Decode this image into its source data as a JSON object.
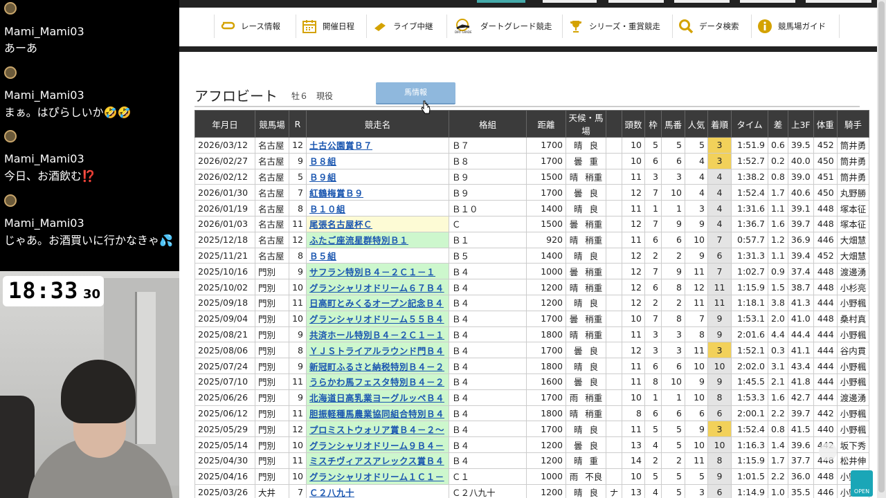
{
  "chat": {
    "messages": [
      {
        "user": "Mami_Mami03",
        "text": "あーあ"
      },
      {
        "user": "Mami_Mami03",
        "text": "まぁ。はぴらしいか🤣🤣"
      },
      {
        "user": "Mami_Mami03",
        "text": "今日、お酒飲む⁉️"
      },
      {
        "user": "Mami_Mami03",
        "text": "じゃあ。お酒買いに行かなきゃ💦"
      }
    ]
  },
  "clock": {
    "hm": "18:33",
    "sec": "30"
  },
  "nav": {
    "items": [
      {
        "label": "レース情報",
        "icon": "race-info-icon"
      },
      {
        "label": "開催日程",
        "icon": "calendar-icon"
      },
      {
        "label": "ライブ中継",
        "icon": "live-icon"
      },
      {
        "label": "ダートグレード競走",
        "icon": "dirt-grade-icon"
      },
      {
        "label": "シリーズ・重賞競走",
        "icon": "trophy-icon"
      },
      {
        "label": "データ検索",
        "icon": "search-icon"
      },
      {
        "label": "競馬場ガイド",
        "icon": "info-icon"
      }
    ]
  },
  "horse": {
    "name": "アフロビート",
    "meta": "牡６　現役",
    "button": "馬情報"
  },
  "table": {
    "headers": [
      "年月日",
      "競馬場",
      "R",
      "競走名",
      "格組",
      "距離",
      "天候・馬場",
      "",
      "頭数",
      "枠",
      "馬番",
      "人気",
      "着順",
      "タイム",
      "差",
      "上3F",
      "体重",
      "騎手"
    ],
    "rows": [
      [
        "2026/03/12",
        "名古屋",
        "12",
        "土古公園賞Ｂ７",
        "Ｂ７",
        "1700",
        "晴",
        "良",
        "",
        "10",
        "5",
        "5",
        "5",
        "3",
        "1:51.9",
        "0.6",
        "39.5",
        "452",
        "筒井勇"
      ],
      [
        "2026/02/27",
        "名古屋",
        "9",
        "Ｂ８組",
        "Ｂ８",
        "1700",
        "曇",
        "重",
        "",
        "10",
        "6",
        "6",
        "4",
        "3",
        "1:52.7",
        "0.2",
        "40.0",
        "450",
        "筒井勇"
      ],
      [
        "2026/02/12",
        "名古屋",
        "5",
        "Ｂ９組",
        "Ｂ９",
        "1500",
        "晴",
        "稍重",
        "",
        "11",
        "3",
        "3",
        "4",
        "4",
        "1:38.2",
        "0.8",
        "39.0",
        "451",
        "筒井勇"
      ],
      [
        "2026/01/30",
        "名古屋",
        "7",
        "紅鶴梅賞Ｂ９",
        "Ｂ９",
        "1700",
        "曇",
        "良",
        "",
        "12",
        "7",
        "10",
        "4",
        "4",
        "1:52.4",
        "1.7",
        "40.6",
        "450",
        "丸野勝"
      ],
      [
        "2026/01/19",
        "名古屋",
        "8",
        "Ｂ１０組",
        "Ｂ１０",
        "1400",
        "晴",
        "良",
        "",
        "11",
        "1",
        "1",
        "3",
        "4",
        "1:31.6",
        "1.1",
        "39.1",
        "448",
        "塚本征"
      ],
      [
        "2026/01/03",
        "名古屋",
        "11",
        "尾張名古屋杯Ｃ",
        "Ｃ",
        "1500",
        "曇",
        "稍重",
        "",
        "12",
        "7",
        "9",
        "9",
        "4",
        "1:36.7",
        "1.6",
        "39.7",
        "448",
        "塚本征"
      ],
      [
        "2025/12/18",
        "名古屋",
        "12",
        "ふたご座流星群特別Ｂ１",
        "Ｂ１",
        "920",
        "晴",
        "稍重",
        "",
        "11",
        "6",
        "6",
        "10",
        "7",
        "0:57.7",
        "1.2",
        "36.9",
        "446",
        "大畑慧"
      ],
      [
        "2025/11/21",
        "名古屋",
        "8",
        "Ｂ５組",
        "Ｂ５",
        "1400",
        "晴",
        "良",
        "",
        "12",
        "2",
        "2",
        "9",
        "6",
        "1:31.3",
        "1.1",
        "39.4",
        "452",
        "大畑慧"
      ],
      [
        "2025/10/16",
        "門別",
        "9",
        "サフラン特別Ｂ４－２Ｃ１－１",
        "Ｂ４",
        "1000",
        "曇",
        "稍重",
        "",
        "12",
        "7",
        "9",
        "11",
        "7",
        "1:02.7",
        "0.9",
        "37.4",
        "448",
        "渡邊湧"
      ],
      [
        "2025/10/02",
        "門別",
        "10",
        "グランシャリオドリーム６７Ｂ４",
        "Ｂ４",
        "1200",
        "晴",
        "稍重",
        "",
        "12",
        "6",
        "8",
        "12",
        "11",
        "1:15.9",
        "1.5",
        "38.7",
        "448",
        "小杉亮"
      ],
      [
        "2025/09/18",
        "門別",
        "11",
        "日高町とみくるオープン記念Ｂ４",
        "Ｂ４",
        "1200",
        "晴",
        "良",
        "",
        "12",
        "2",
        "2",
        "11",
        "11",
        "1:18.1",
        "3.8",
        "41.3",
        "444",
        "小野楓"
      ],
      [
        "2025/09/04",
        "門別",
        "10",
        "グランシャリオドリーム５５Ｂ４",
        "Ｂ４",
        "1700",
        "曇",
        "稍重",
        "",
        "10",
        "7",
        "8",
        "7",
        "9",
        "1:53.1",
        "2.0",
        "41.0",
        "448",
        "桑村真"
      ],
      [
        "2025/08/21",
        "門別",
        "9",
        "共済ホール特別Ｂ４－２Ｃ１－１",
        "Ｂ４",
        "1800",
        "晴",
        "稍重",
        "",
        "11",
        "3",
        "3",
        "8",
        "9",
        "2:01.6",
        "4.4",
        "44.4",
        "444",
        "小野楓"
      ],
      [
        "2025/08/06",
        "門別",
        "8",
        "ＹＪＳトライアルラウンド門Ｂ４",
        "Ｂ４",
        "1700",
        "曇",
        "良",
        "",
        "12",
        "3",
        "3",
        "11",
        "3",
        "1:52.1",
        "0.3",
        "41.1",
        "444",
        "谷内貫"
      ],
      [
        "2025/07/24",
        "門別",
        "9",
        "新冠町ふるさと納税特別Ｂ４－２",
        "Ｂ４",
        "1800",
        "晴",
        "良",
        "",
        "11",
        "6",
        "6",
        "10",
        "10",
        "2:02.0",
        "3.1",
        "43.4",
        "444",
        "小野楓"
      ],
      [
        "2025/07/10",
        "門別",
        "11",
        "うらかわ馬フェスタ特別Ｂ４－２",
        "Ｂ４",
        "1600",
        "曇",
        "良",
        "",
        "11",
        "8",
        "10",
        "9",
        "9",
        "1:45.5",
        "2.1",
        "41.8",
        "444",
        "小野楓"
      ],
      [
        "2025/06/26",
        "門別",
        "9",
        "北海道日高乳業ヨーグルッペＢ４",
        "Ｂ４",
        "1700",
        "雨",
        "稍重",
        "",
        "10",
        "1",
        "1",
        "10",
        "8",
        "1:53.3",
        "1.6",
        "42.7",
        "444",
        "渡邊湧"
      ],
      [
        "2025/06/12",
        "門別",
        "11",
        "胆振軽種馬農業協同組合特別Ｂ４",
        "Ｂ４",
        "1800",
        "晴",
        "稍重",
        "",
        "8",
        "6",
        "6",
        "6",
        "6",
        "2:00.1",
        "2.2",
        "39.7",
        "442",
        "小野楓"
      ],
      [
        "2025/05/29",
        "門別",
        "12",
        "プロミストウォリア賞Ｂ４－２～",
        "Ｂ４",
        "1700",
        "晴",
        "良",
        "",
        "11",
        "5",
        "5",
        "9",
        "3",
        "1:52.4",
        "0.8",
        "41.5",
        "440",
        "小野楓"
      ],
      [
        "2025/05/14",
        "門別",
        "10",
        "グランシャリオドリーム９Ｂ４－",
        "Ｂ４",
        "1200",
        "曇",
        "良",
        "",
        "13",
        "4",
        "5",
        "10",
        "10",
        "1:16.3",
        "1.4",
        "39.6",
        "442",
        "坂下秀"
      ],
      [
        "2025/04/30",
        "門別",
        "11",
        "ミスチヴィアスアレックス賞Ｂ４",
        "Ｂ４",
        "1200",
        "晴",
        "重",
        "",
        "14",
        "2",
        "2",
        "11",
        "8",
        "1:15.9",
        "1.7",
        "37.7",
        "448",
        "松井伸"
      ],
      [
        "2025/04/16",
        "門別",
        "10",
        "グランシャリオドリーム１Ｃ１－",
        "Ｃ１",
        "1000",
        "雨",
        "不良",
        "",
        "10",
        "5",
        "5",
        "5",
        "9",
        "1:01.5",
        "2.2",
        "36.0",
        "448",
        "小野楓"
      ],
      [
        "2025/03/26",
        "大井",
        "7",
        "Ｃ２八九十",
        "Ｃ２八九十",
        "1200",
        "晴",
        "良",
        "ナ",
        "13",
        "4",
        "5",
        "3",
        "6",
        "1:14.9",
        "1.0",
        "35.5",
        "446",
        "小野楓"
      ]
    ],
    "highlights": {
      "green_rows": [
        6,
        8,
        9,
        10,
        11,
        12,
        13,
        14,
        15,
        16,
        17,
        18,
        19,
        20,
        21
      ],
      "yellow_rows": [
        5
      ],
      "gold_finish_rows": [
        0,
        1,
        13,
        18
      ]
    }
  },
  "badge": {
    "open": "OPEN"
  },
  "colors": {
    "header_bg": "#3b3b3b",
    "link": "#1a56b0",
    "green": "#cdf7cd",
    "gold": "#f2d15a",
    "button": "#8fb8dd"
  }
}
